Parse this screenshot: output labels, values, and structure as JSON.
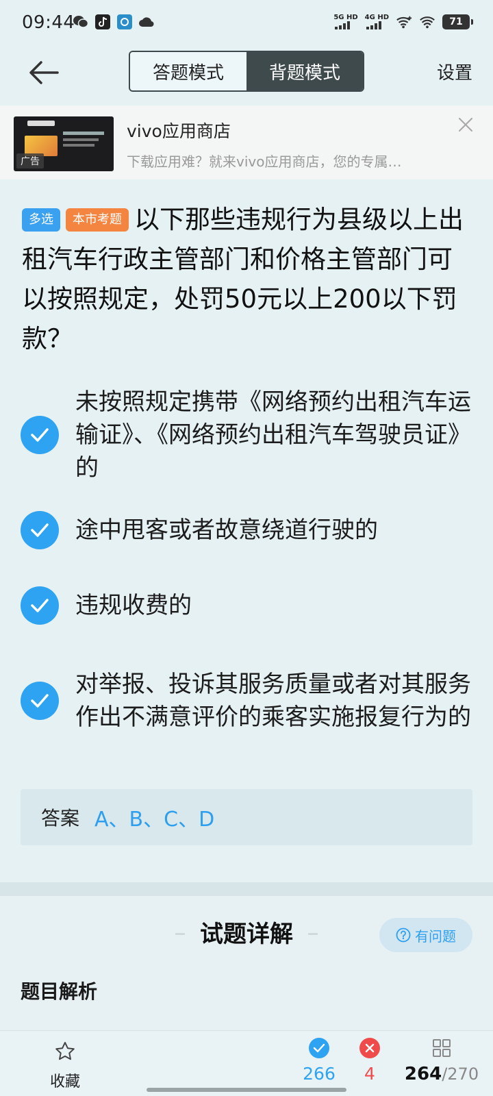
{
  "status_bar": {
    "time": "09:44",
    "network_1": "5G HD",
    "network_2": "4G HD",
    "battery": "71"
  },
  "header": {
    "modes": [
      "答题模式",
      "背题模式"
    ],
    "active_mode": "背题模式",
    "settings_label": "设置"
  },
  "ad": {
    "title": "vivo应用商店",
    "description": "下载应用难？就来vivo应用商店，您的专属…",
    "tag": "广告"
  },
  "question": {
    "type_tag": "多选",
    "source_tag": "本市考题",
    "text": "以下那些违规行为县级以上出租汽车行政主管部门和价格主管部门可以按照规定，处罚50元以上200以下罚款？"
  },
  "options": [
    {
      "text": "未按照规定携带《网络预约出租汽车运输证》、《网络预约出租汽车驾驶员证》的",
      "selected": true
    },
    {
      "text": "途中甩客或者故意绕道行驶的",
      "selected": true
    },
    {
      "text": "违规收费的",
      "selected": true
    },
    {
      "text": "对举报、投诉其服务质量或者对其服务作出不满意评价的乘客实施报复行为的",
      "selected": true
    }
  ],
  "answer": {
    "label": "答案",
    "value": "A、B、C、D"
  },
  "detail": {
    "title": "试题详解",
    "question_button": "有问题",
    "analysis_label": "题目解析"
  },
  "bottom_bar": {
    "favorite_label": "收藏",
    "correct_count": "266",
    "wrong_count": "4",
    "current": "264",
    "total": "/270"
  },
  "colors": {
    "accent": "#2ea3f2",
    "wrong": "#f04b4b",
    "tag_local": "#f38541",
    "background": "#e6f1f4"
  }
}
